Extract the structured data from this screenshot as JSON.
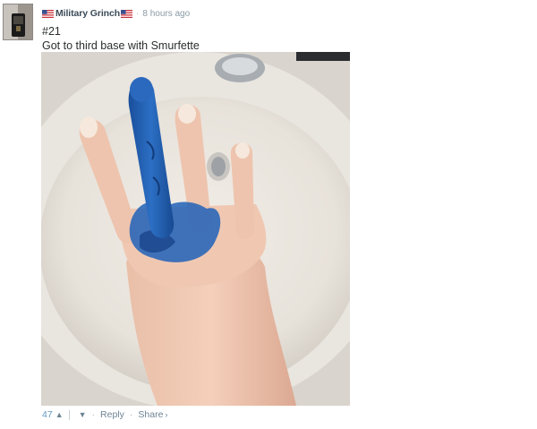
{
  "comment": {
    "author": "Military Grinch",
    "timestamp": "8 hours ago",
    "body_lines": [
      "#21",
      "Got to third base with Smurfette"
    ],
    "votes": "47",
    "actions": {
      "reply": "Reply",
      "share": "Share"
    },
    "icons": {
      "flag": "us-flag-icon",
      "upvote": "chevron-up-icon",
      "downvote": "chevron-down-icon",
      "share": "chevron-right-icon"
    },
    "colors": {
      "author": "#3b4b58",
      "votes": "#5e98c6",
      "meta": "#8a9ba6",
      "blue_dye": "#1f5fb3"
    }
  }
}
